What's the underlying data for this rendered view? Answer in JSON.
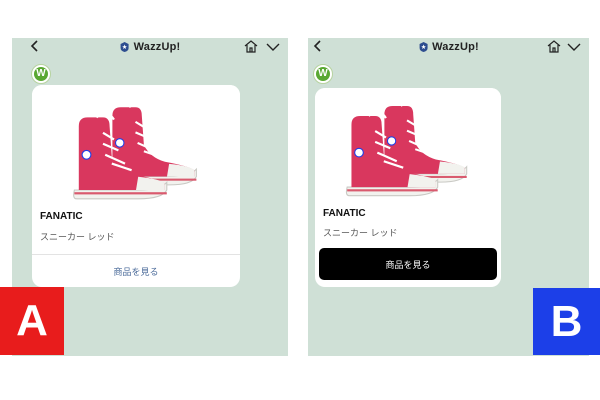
{
  "variants": [
    {
      "label": "A",
      "app_title": "WazzUp!",
      "product": {
        "brand": "FANATIC",
        "description": "スニーカー レッド",
        "button": "商品を見る"
      }
    },
    {
      "label": "B",
      "app_title": "WazzUp!",
      "product": {
        "brand": "FANATIC",
        "description": "スニーカー レッド",
        "button": "商品を見る"
      }
    }
  ],
  "avatar_letter": "W",
  "colors": {
    "chat_background": "#cfe0d6",
    "label_a": "#e81c1c",
    "label_b": "#1c3fe8",
    "button_b": "#000000",
    "button_a_text": "#4a6a99",
    "sneaker": "#d9375e"
  },
  "icons": [
    "back-icon",
    "verified-badge-icon",
    "home-icon",
    "chevron-down-icon"
  ]
}
